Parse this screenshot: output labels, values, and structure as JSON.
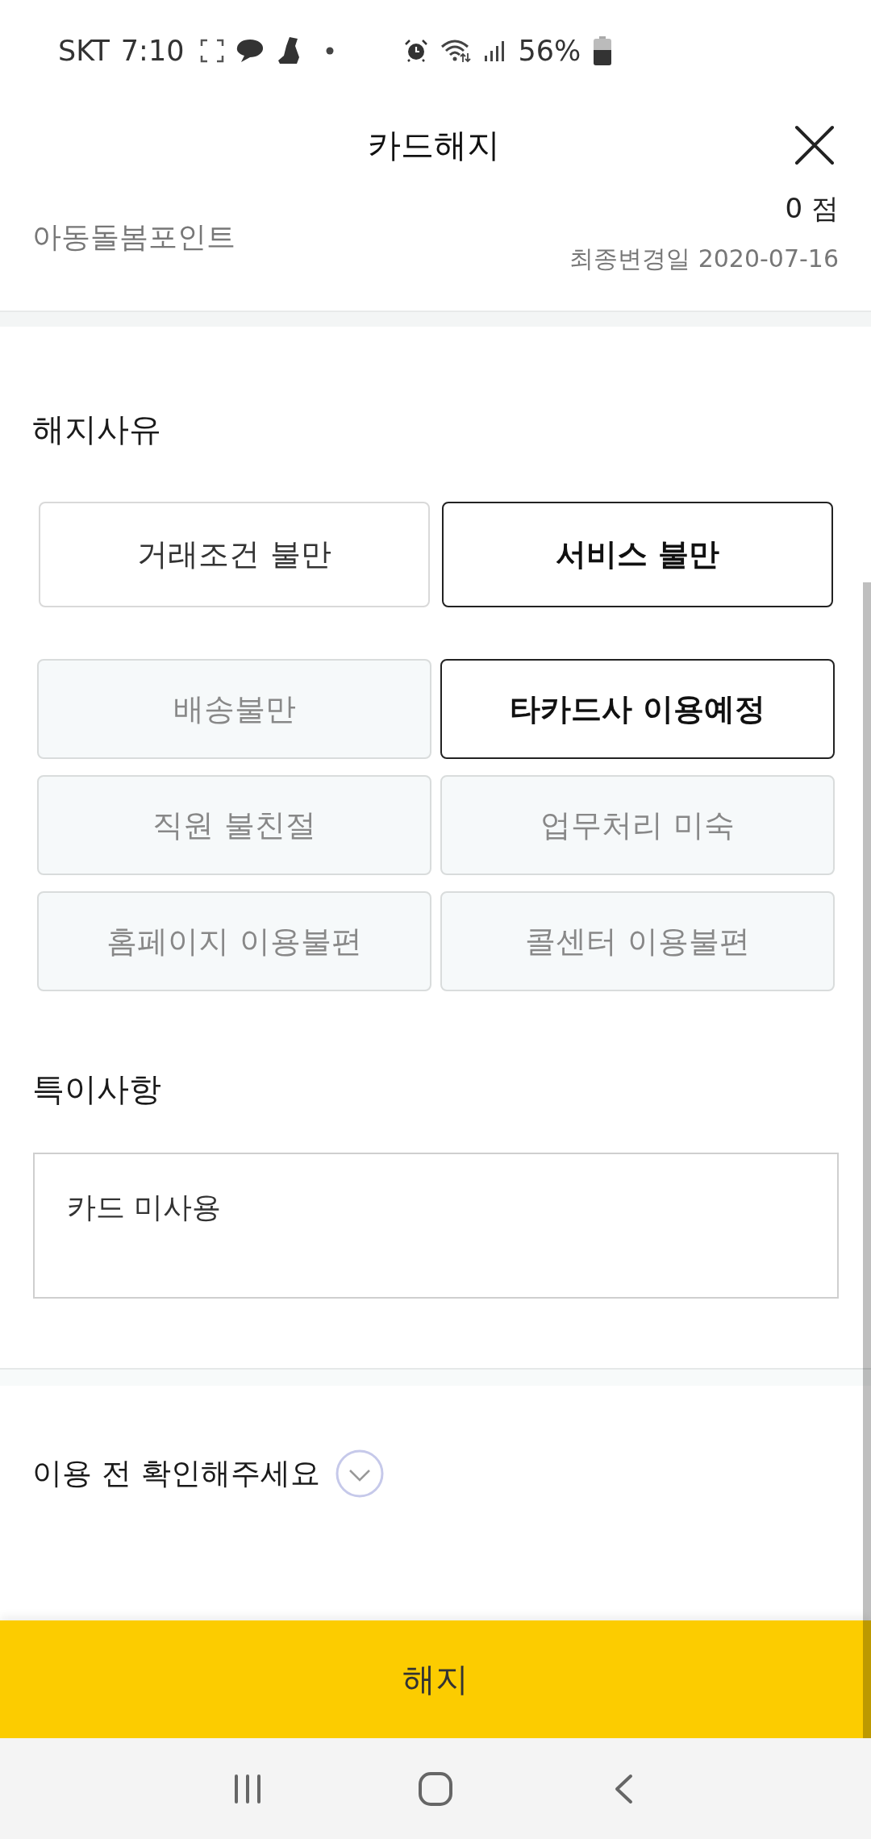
{
  "status_bar": {
    "carrier": "SKT",
    "time": "7:10",
    "battery": "56%"
  },
  "header": {
    "title": "카드해지"
  },
  "point": {
    "name": "아동돌봄포인트",
    "value": "0 점",
    "updated": "최종변경일 2020-07-16"
  },
  "reason": {
    "title": "해지사유",
    "categories": [
      {
        "label": "거래조건 불만",
        "selected": false
      },
      {
        "label": "서비스 불만",
        "selected": true
      }
    ],
    "details": [
      {
        "label": "배송불만",
        "selected": false
      },
      {
        "label": "타카드사 이용예정",
        "selected": true
      },
      {
        "label": "직원 불친절",
        "selected": false
      },
      {
        "label": "업무처리 미숙",
        "selected": false
      },
      {
        "label": "홈페이지 이용불편",
        "selected": false
      },
      {
        "label": "콜센터 이용불편",
        "selected": false
      }
    ]
  },
  "remarks": {
    "title": "특이사항",
    "value": "카드 미사용"
  },
  "notice": {
    "title": "이용 전 확인해주세요",
    "expanded": false
  },
  "submit_button": {
    "label": "해지"
  }
}
